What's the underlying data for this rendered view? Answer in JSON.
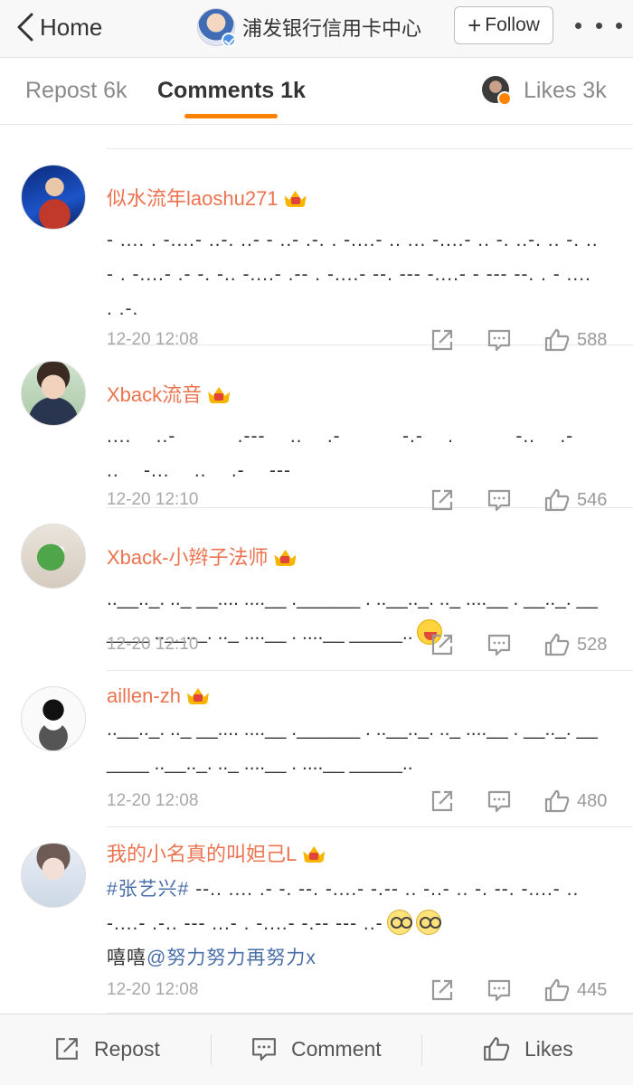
{
  "nav": {
    "back_label": "Home",
    "title": "浦发银行信用卡中心",
    "follow_label": "Follow"
  },
  "tabs": {
    "repost": "Repost 6k",
    "comments": "Comments 1k",
    "likes": "Likes 3k"
  },
  "colors": {
    "accent": "#ff8200",
    "username": "#eb7350",
    "link": "#4a6fa8",
    "meta": "#a8a8a8"
  },
  "comments": [
    {
      "username": "似水流年laoshu271",
      "text": "- .... . -....- ..-. ..- - ..- .-. . -....- .. ... -....- .. -. ..-. .. -. .. - . -....- .- -. -.. -....- .-- . -....- --. --- -....- - --- --. . - .... . .-.",
      "time": "12-20 12:08",
      "likes": "588"
    },
    {
      "username": "Xback流音",
      "text": "....    ..-          .---    ..    .-          -.-    .          -..    .-    ..    -...    ..    .-    ---",
      "time": "12-20 12:10",
      "likes": "546"
    },
    {
      "username": "Xback-小辫子法师",
      "text": "..__.._. .._ __.... ....__ .______ . ..__.._. .._ ....__ . __.._. ______ ..__.._. .._ ....__ . ....__ _____..",
      "time": "12-20 12:10",
      "likes": "528"
    },
    {
      "username": "aillen-zh",
      "text": "..__.._. .._ __.... ....__ .______ . ..__.._. .._ ....__ . __.._. ______ ..__.._. .._ ....__ . ....__ _____..",
      "time": "12-20 12:08",
      "likes": "480"
    },
    {
      "username": "我的小名真的叫妲己L",
      "hashtag": "#张艺兴#",
      "text": " --.. .... .- -. --. -....- -.-- .. -..- .. -. --. -....- .. -....- .-.. --- ...- . -....- -.-- --- ..-",
      "text2": "嘻嘻",
      "mention": "@努力努力再努力x",
      "time": "12-20 12:08",
      "likes": "445"
    }
  ],
  "bottom_bar": {
    "repost": "Repost",
    "comment": "Comment",
    "likes": "Likes"
  },
  "icons": [
    "chevron-left-icon",
    "verified-icon",
    "more-icon",
    "crown-icon",
    "share-icon",
    "reply-icon",
    "thumbs-up-icon"
  ]
}
